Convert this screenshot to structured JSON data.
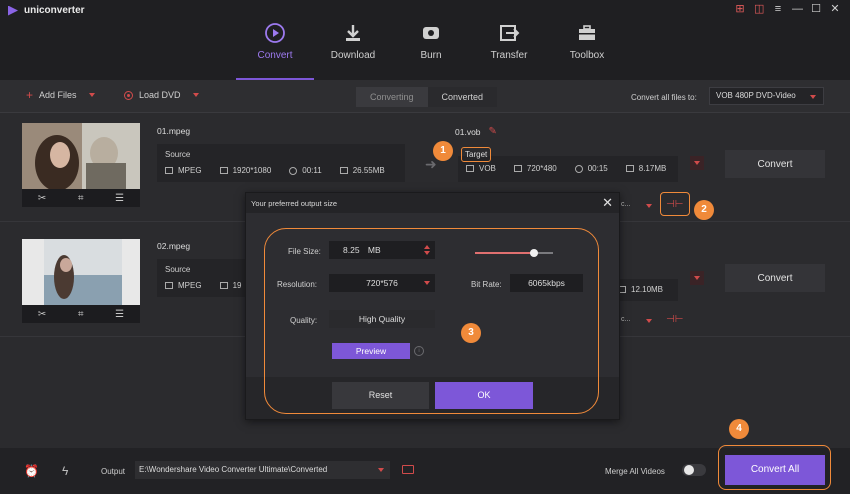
{
  "app": {
    "title": "uniconverter"
  },
  "window_controls": [
    "cart-icon",
    "gift-icon",
    "menu-icon",
    "minimize-icon",
    "maximize-icon",
    "close-icon"
  ],
  "nav": [
    {
      "label": "Convert",
      "icon": "convert-icon",
      "active": true
    },
    {
      "label": "Download",
      "icon": "download-icon",
      "active": false
    },
    {
      "label": "Burn",
      "icon": "burn-icon",
      "active": false
    },
    {
      "label": "Transfer",
      "icon": "transfer-icon",
      "active": false
    },
    {
      "label": "Toolbox",
      "icon": "toolbox-icon",
      "active": false
    }
  ],
  "toolbar": {
    "add_files": "Add Files",
    "load_dvd": "Load DVD",
    "tab_converting": "Converting",
    "tab_converted": "Converted",
    "convert_all_to_label": "Convert all files to:",
    "convert_all_to_value": "VOB 480P DVD-Video"
  },
  "files": [
    {
      "name": "01.mpeg",
      "source_label": "Source",
      "source": {
        "format": "MPEG",
        "resolution": "1920*1080",
        "duration": "00:11",
        "size": "26.55MB"
      },
      "target_name": "01.vob",
      "target_label": "Target",
      "target": {
        "format": "VOB",
        "resolution": "720*480",
        "duration": "00:15",
        "size": "8.17MB"
      },
      "format_short": "c...",
      "convert_label": "Convert"
    },
    {
      "name": "02.mpeg",
      "source_label": "Source",
      "source": {
        "format": "MPEG",
        "resolution_partial": "19"
      },
      "target": {
        "size": "12.10MB"
      },
      "format_short": "c...",
      "convert_label": "Convert"
    }
  ],
  "modal": {
    "title": "Your preferred output size",
    "file_size_label": "File Size:",
    "file_size_value": "8.25",
    "file_size_unit": "MB",
    "resolution_label": "Resolution:",
    "resolution_value": "720*576",
    "quality_label": "Quality:",
    "quality_value": "High Quality",
    "bitrate_label": "Bit Rate:",
    "bitrate_value": "6065kbps",
    "slider_fraction": 0.75,
    "preview_label": "Preview",
    "info_glyph": "i",
    "reset_label": "Reset",
    "ok_label": "OK"
  },
  "callouts": [
    "1",
    "2",
    "3",
    "4"
  ],
  "bottom": {
    "output_label": "Output",
    "output_path": "E:\\Wondershare Video Converter Ultimate\\Converted",
    "merge_label": "Merge All Videos",
    "merge_on": false,
    "convert_all_label": "Convert All"
  },
  "colors": {
    "accent": "#7d57d8",
    "callout": "#f08a3a",
    "red": "#d14b4b"
  }
}
